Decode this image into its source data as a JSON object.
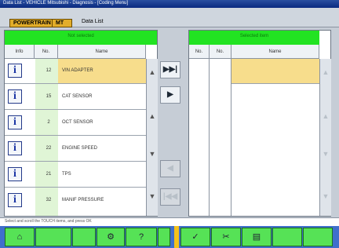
{
  "window": {
    "title": "Data List - VEHICLE Mitsubishi - Diagnosis - [Coding Menu]"
  },
  "tabs": {
    "tab1": "POWERTRAIN",
    "tab2": "MT",
    "crumb": "Data List"
  },
  "left_panel": {
    "header": "Not selected",
    "columns": {
      "info": "Info",
      "no": "No.",
      "name": "Name"
    },
    "rows": [
      {
        "no": "12",
        "name": "VIN ADAPTER"
      },
      {
        "no": "15",
        "name": "CAT SENSOR"
      },
      {
        "no": "2",
        "name": "OCT SENSOR"
      },
      {
        "no": "22",
        "name": "ENGINE SPEED"
      },
      {
        "no": "21",
        "name": "TPS"
      },
      {
        "no": "32",
        "name": "MANIF PRESSURE"
      }
    ]
  },
  "right_panel": {
    "header": "Selected item",
    "columns": {
      "no1": "No.",
      "no2": "No.",
      "name": "Name"
    }
  },
  "transfer": {
    "add_all": "▶▶|",
    "add": "▶",
    "remove": "◀",
    "remove_all": "|◀◀"
  },
  "status": {
    "text": "Select and scroll the TOUCH items, and press OK"
  },
  "bottom": {
    "home_icon": "⌂",
    "tool_icon": "⚙",
    "help_icon": "?",
    "ok_icon": "✓",
    "cancel_icon": "✂",
    "list_icon": "▤"
  },
  "colors": {
    "green_header": "#22e322",
    "selected_row": "#f7dd8c",
    "tab": "#e2ad2a"
  }
}
